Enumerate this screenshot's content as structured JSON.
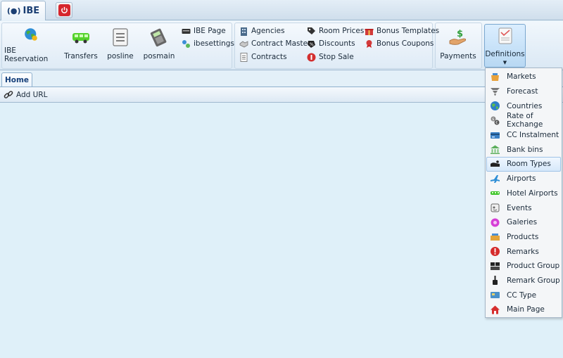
{
  "app": {
    "tab_label": "IBE"
  },
  "ribbon": {
    "big_buttons": [
      {
        "label": "IBE Reservation",
        "icon": "globe-icon"
      },
      {
        "label": "Transfers",
        "icon": "bus-icon"
      },
      {
        "label": "posline",
        "icon": "list-icon"
      },
      {
        "label": "posmain",
        "icon": "pos-terminal-icon"
      }
    ],
    "small_col1": [
      {
        "label": "IBE Page",
        "icon": "page-icon"
      },
      {
        "label": "ibesettings",
        "icon": "settings-icon"
      }
    ],
    "small_col2": [
      {
        "label": "Agencies",
        "icon": "building-icon"
      },
      {
        "label": "Contract Master",
        "icon": "handshake-icon"
      },
      {
        "label": "Contracts",
        "icon": "document-icon"
      }
    ],
    "small_col3": [
      {
        "label": "Room Prices",
        "icon": "price-tag-icon"
      },
      {
        "label": "Discounts",
        "icon": "discount-icon"
      },
      {
        "label": "Stop Sale",
        "icon": "stop-icon"
      }
    ],
    "small_col4": [
      {
        "label": "Bonus Templates",
        "icon": "gift-icon"
      },
      {
        "label": "Bonus Coupons",
        "icon": "coupon-icon"
      }
    ],
    "payments": {
      "label": "Payments",
      "icon": "money-hand-icon"
    },
    "definitions": {
      "label": "Definitions",
      "icon": "definitions-icon"
    }
  },
  "tabs": {
    "home": "Home"
  },
  "toolbar": {
    "add_url": "Add URL"
  },
  "menu": {
    "items": [
      {
        "label": "Markets",
        "icon": "market-icon"
      },
      {
        "label": "Forecast",
        "icon": "tornado-icon"
      },
      {
        "label": "Countries",
        "icon": "globe-icon"
      },
      {
        "label": "Rate of Exchange",
        "icon": "exchange-icon"
      },
      {
        "label": "CC Instalment",
        "icon": "credit-card-icon"
      },
      {
        "label": "Bank bins",
        "icon": "bank-icon"
      },
      {
        "label": "Room Types",
        "icon": "bed-icon"
      },
      {
        "label": "Airports",
        "icon": "airplane-icon"
      },
      {
        "label": "Hotel Airports",
        "icon": "shuttle-icon"
      },
      {
        "label": "Events",
        "icon": "events-icon"
      },
      {
        "label": "Galeries",
        "icon": "gallery-icon"
      },
      {
        "label": "Products",
        "icon": "products-icon"
      },
      {
        "label": "Remarks",
        "icon": "alert-icon"
      },
      {
        "label": "Product Group",
        "icon": "product-group-icon"
      },
      {
        "label": "Remark Group",
        "icon": "remark-group-icon"
      },
      {
        "label": "CC Type",
        "icon": "card-type-icon"
      },
      {
        "label": "Main Page",
        "icon": "home-icon"
      }
    ],
    "active": "Room Types"
  }
}
